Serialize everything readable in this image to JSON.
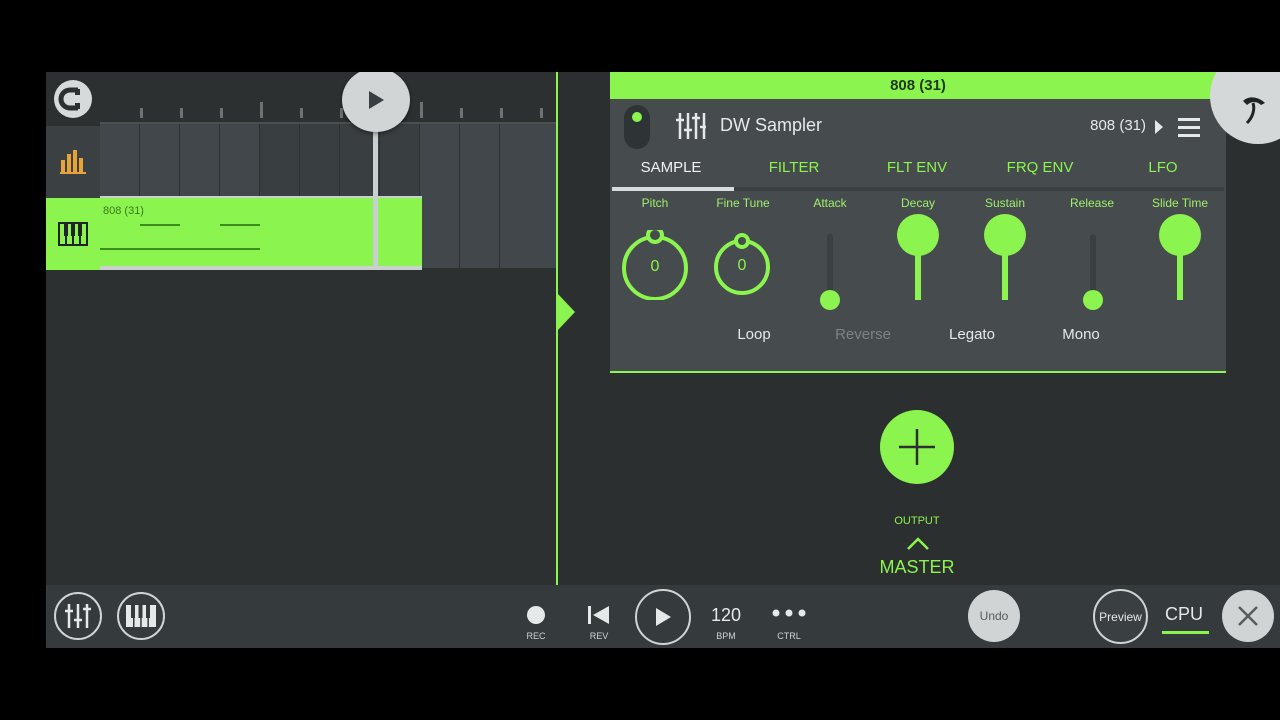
{
  "playlist": {
    "clip_label": "808 (31)"
  },
  "channel": {
    "title": "808 (31)",
    "instrument_name": "DW Sampler",
    "preset_name": "808 (31)",
    "tabs": [
      "SAMPLE",
      "FILTER",
      "FLT ENV",
      "FRQ ENV",
      "LFO"
    ],
    "active_tab": "SAMPLE",
    "params": {
      "pitch": {
        "label": "Pitch",
        "value": "0"
      },
      "fine_tune": {
        "label": "Fine Tune",
        "value": "0"
      },
      "attack": {
        "label": "Attack",
        "level": 0.0
      },
      "decay": {
        "label": "Decay",
        "level": 1.0
      },
      "sustain": {
        "label": "Sustain",
        "level": 1.0
      },
      "release": {
        "label": "Release",
        "level": 0.0
      },
      "slide_time": {
        "label": "Slide Time",
        "level": 1.0
      }
    },
    "options": {
      "loop": "Loop",
      "reverse": "Reverse",
      "legato": "Legato",
      "mono": "Mono"
    }
  },
  "output": {
    "label": "OUTPUT",
    "target": "MASTER"
  },
  "transport": {
    "rec_label": "REC",
    "rev_label": "REV",
    "bpm_value": "120",
    "bpm_label": "BPM",
    "ctrl_label": "CTRL",
    "undo_label": "Undo",
    "preview_label": "Preview",
    "cpu_label": "CPU"
  },
  "colors": {
    "accent": "#8cf44e",
    "background": "#2b2f30",
    "panel": "#464b4d"
  },
  "icons": [
    "magnet-icon",
    "mixer-bars-icon",
    "piano-icon",
    "play-icon",
    "equalizer-icon",
    "menu-icon",
    "fruit-logo-icon",
    "plus-icon",
    "rewind-icon",
    "ellipsis-icon",
    "close-icon"
  ]
}
